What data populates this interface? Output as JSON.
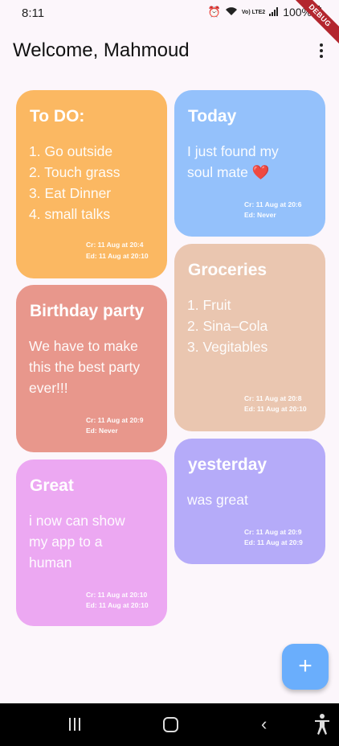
{
  "status_bar": {
    "time": "8:11",
    "signal_text": "Vo) LTE2",
    "battery": "100%"
  },
  "debug_banner": "DEBUG",
  "app_bar": {
    "title": "Welcome, Mahmoud"
  },
  "notes": [
    {
      "title": "To DO:",
      "body": "1. Go outside\n2. Touch grass\n3. Eat Dinner\n4. small talks",
      "created": "Cr: 11 Aug at 20:4",
      "edited": "Ed: 11 Aug at 20:10",
      "color": "#fbb862"
    },
    {
      "title": "Birthday party",
      "body": "We have to make\nthis the best party\never!!!",
      "created": "Cr: 11 Aug at 20:9",
      "edited": "Ed: Never",
      "color": "#e8978c"
    },
    {
      "title": "Great",
      "body": "i now can show\nmy app to a\nhuman",
      "created": "Cr: 11 Aug at 20:10",
      "edited": "Ed: 11 Aug at 20:10",
      "color": "#eca8f2"
    },
    {
      "title": "Today",
      "body": "I just found my\nsoul mate ❤️",
      "created": "Cr: 11 Aug at 20:6",
      "edited": "Ed: Never",
      "color": "#94c1fb"
    },
    {
      "title": "Groceries",
      "body": "1. Fruit\n2. Sina–Cola\n3. Vegitables",
      "created": "Cr: 11 Aug at 20:8",
      "edited": "Ed: 11 Aug at 20:10",
      "color": "#eac6b0"
    },
    {
      "title": "yesterday",
      "body": "was great",
      "created": "Cr: 11 Aug at 20:9",
      "edited": "Ed: 11 Aug at 20:9",
      "color": "#b5abf9"
    }
  ],
  "fab": {
    "icon": "plus-icon",
    "label": "+",
    "color": "#6aaefc"
  },
  "nav_bar": {
    "back_label": "‹"
  }
}
